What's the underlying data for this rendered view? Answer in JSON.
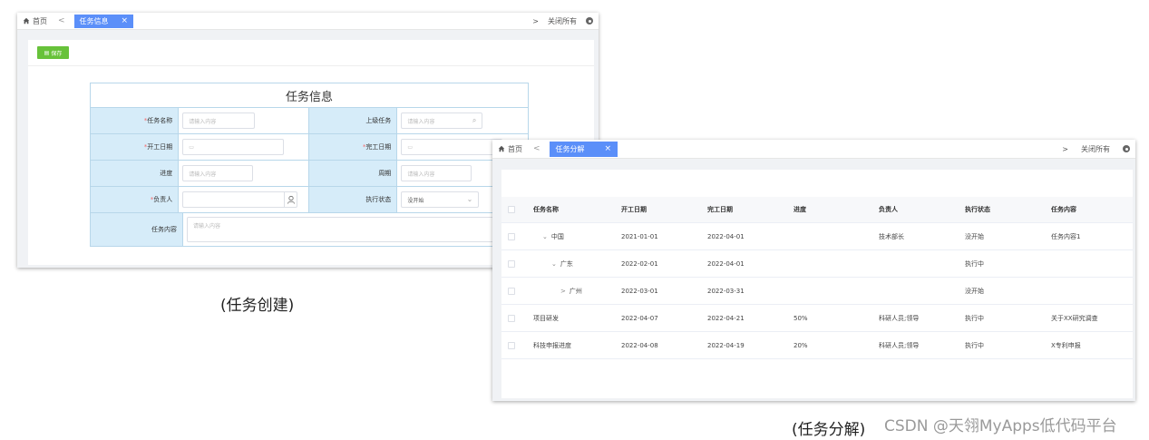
{
  "window1": {
    "tabbar": {
      "home_label": "首页",
      "prev_arrow": "<",
      "active_tab": "任务信息",
      "close_x": "×",
      "next_arrow": ">",
      "close_all": "关闭所有"
    },
    "toolbar": {
      "save_label": "保存"
    },
    "form": {
      "title": "任务信息",
      "rows": [
        {
          "l1": "任务名称",
          "r1": true,
          "p1": "请输入内容",
          "l2": "上级任务",
          "r2": false,
          "p2": "请输入内容"
        },
        {
          "l1": "开工日期",
          "r1": true,
          "p1": "",
          "l2": "完工日期",
          "r2": true,
          "p2": ""
        },
        {
          "l1": "进度",
          "r1": false,
          "p1": "请输入内容",
          "l2": "周期",
          "r2": false,
          "p2": "请输入内容"
        },
        {
          "l1": "负责人",
          "r1": true,
          "p1": "",
          "l2": "执行状态",
          "r2": false,
          "p2": "没开始"
        }
      ],
      "content_label": "任务内容",
      "content_placeholder": "请输入内容",
      "required_mark": "*"
    },
    "caption": "(任务创建)"
  },
  "window2": {
    "tabbar": {
      "home_label": "首页",
      "prev_arrow": "<",
      "active_tab": "任务分解",
      "close_x": "×",
      "next_arrow": ">",
      "close_all": "关闭所有"
    },
    "table": {
      "columns": [
        "任务名称",
        "开工日期",
        "完工日期",
        "进度",
        "负责人",
        "执行状态",
        "任务内容"
      ],
      "rows": [
        {
          "indent": 0,
          "toggle": "⌄",
          "name": "中国",
          "start": "2021-01-01",
          "end": "2022-04-01",
          "progress": "",
          "owner": "技术部长",
          "status": "没开始",
          "content": "任务内容1"
        },
        {
          "indent": 1,
          "toggle": "⌄",
          "name": "广东",
          "start": "2022-02-01",
          "end": "2022-04-01",
          "progress": "",
          "owner": "",
          "status": "执行中",
          "content": ""
        },
        {
          "indent": 2,
          "toggle": ">",
          "name": "广州",
          "start": "2022-03-01",
          "end": "2022-03-31",
          "progress": "",
          "owner": "",
          "status": "没开始",
          "content": ""
        },
        {
          "indent": 0,
          "toggle": "",
          "name": "项目研发",
          "start": "2022-04-07",
          "end": "2022-04-21",
          "progress": "50%",
          "owner": "科研人员;领导",
          "status": "执行中",
          "content": "关于XX研究调查"
        },
        {
          "indent": 0,
          "toggle": "",
          "name": "科技申报进度",
          "start": "2022-04-08",
          "end": "2022-04-19",
          "progress": "20%",
          "owner": "科研人员;领导",
          "status": "执行中",
          "content": "X专利申报"
        }
      ]
    },
    "caption": "(任务分解)"
  },
  "watermark": "CSDN @天翎MyApps低代码平台",
  "colors": {
    "tab_active": "#5b8ff9",
    "save_button": "#67c23a",
    "label_bg": "#d6ecf9",
    "required": "#f56c6c"
  },
  "icons": [
    "home-icon",
    "gear-icon",
    "save-icon",
    "calendar-icon",
    "search-icon",
    "user-icon",
    "chevron-down-icon"
  ]
}
